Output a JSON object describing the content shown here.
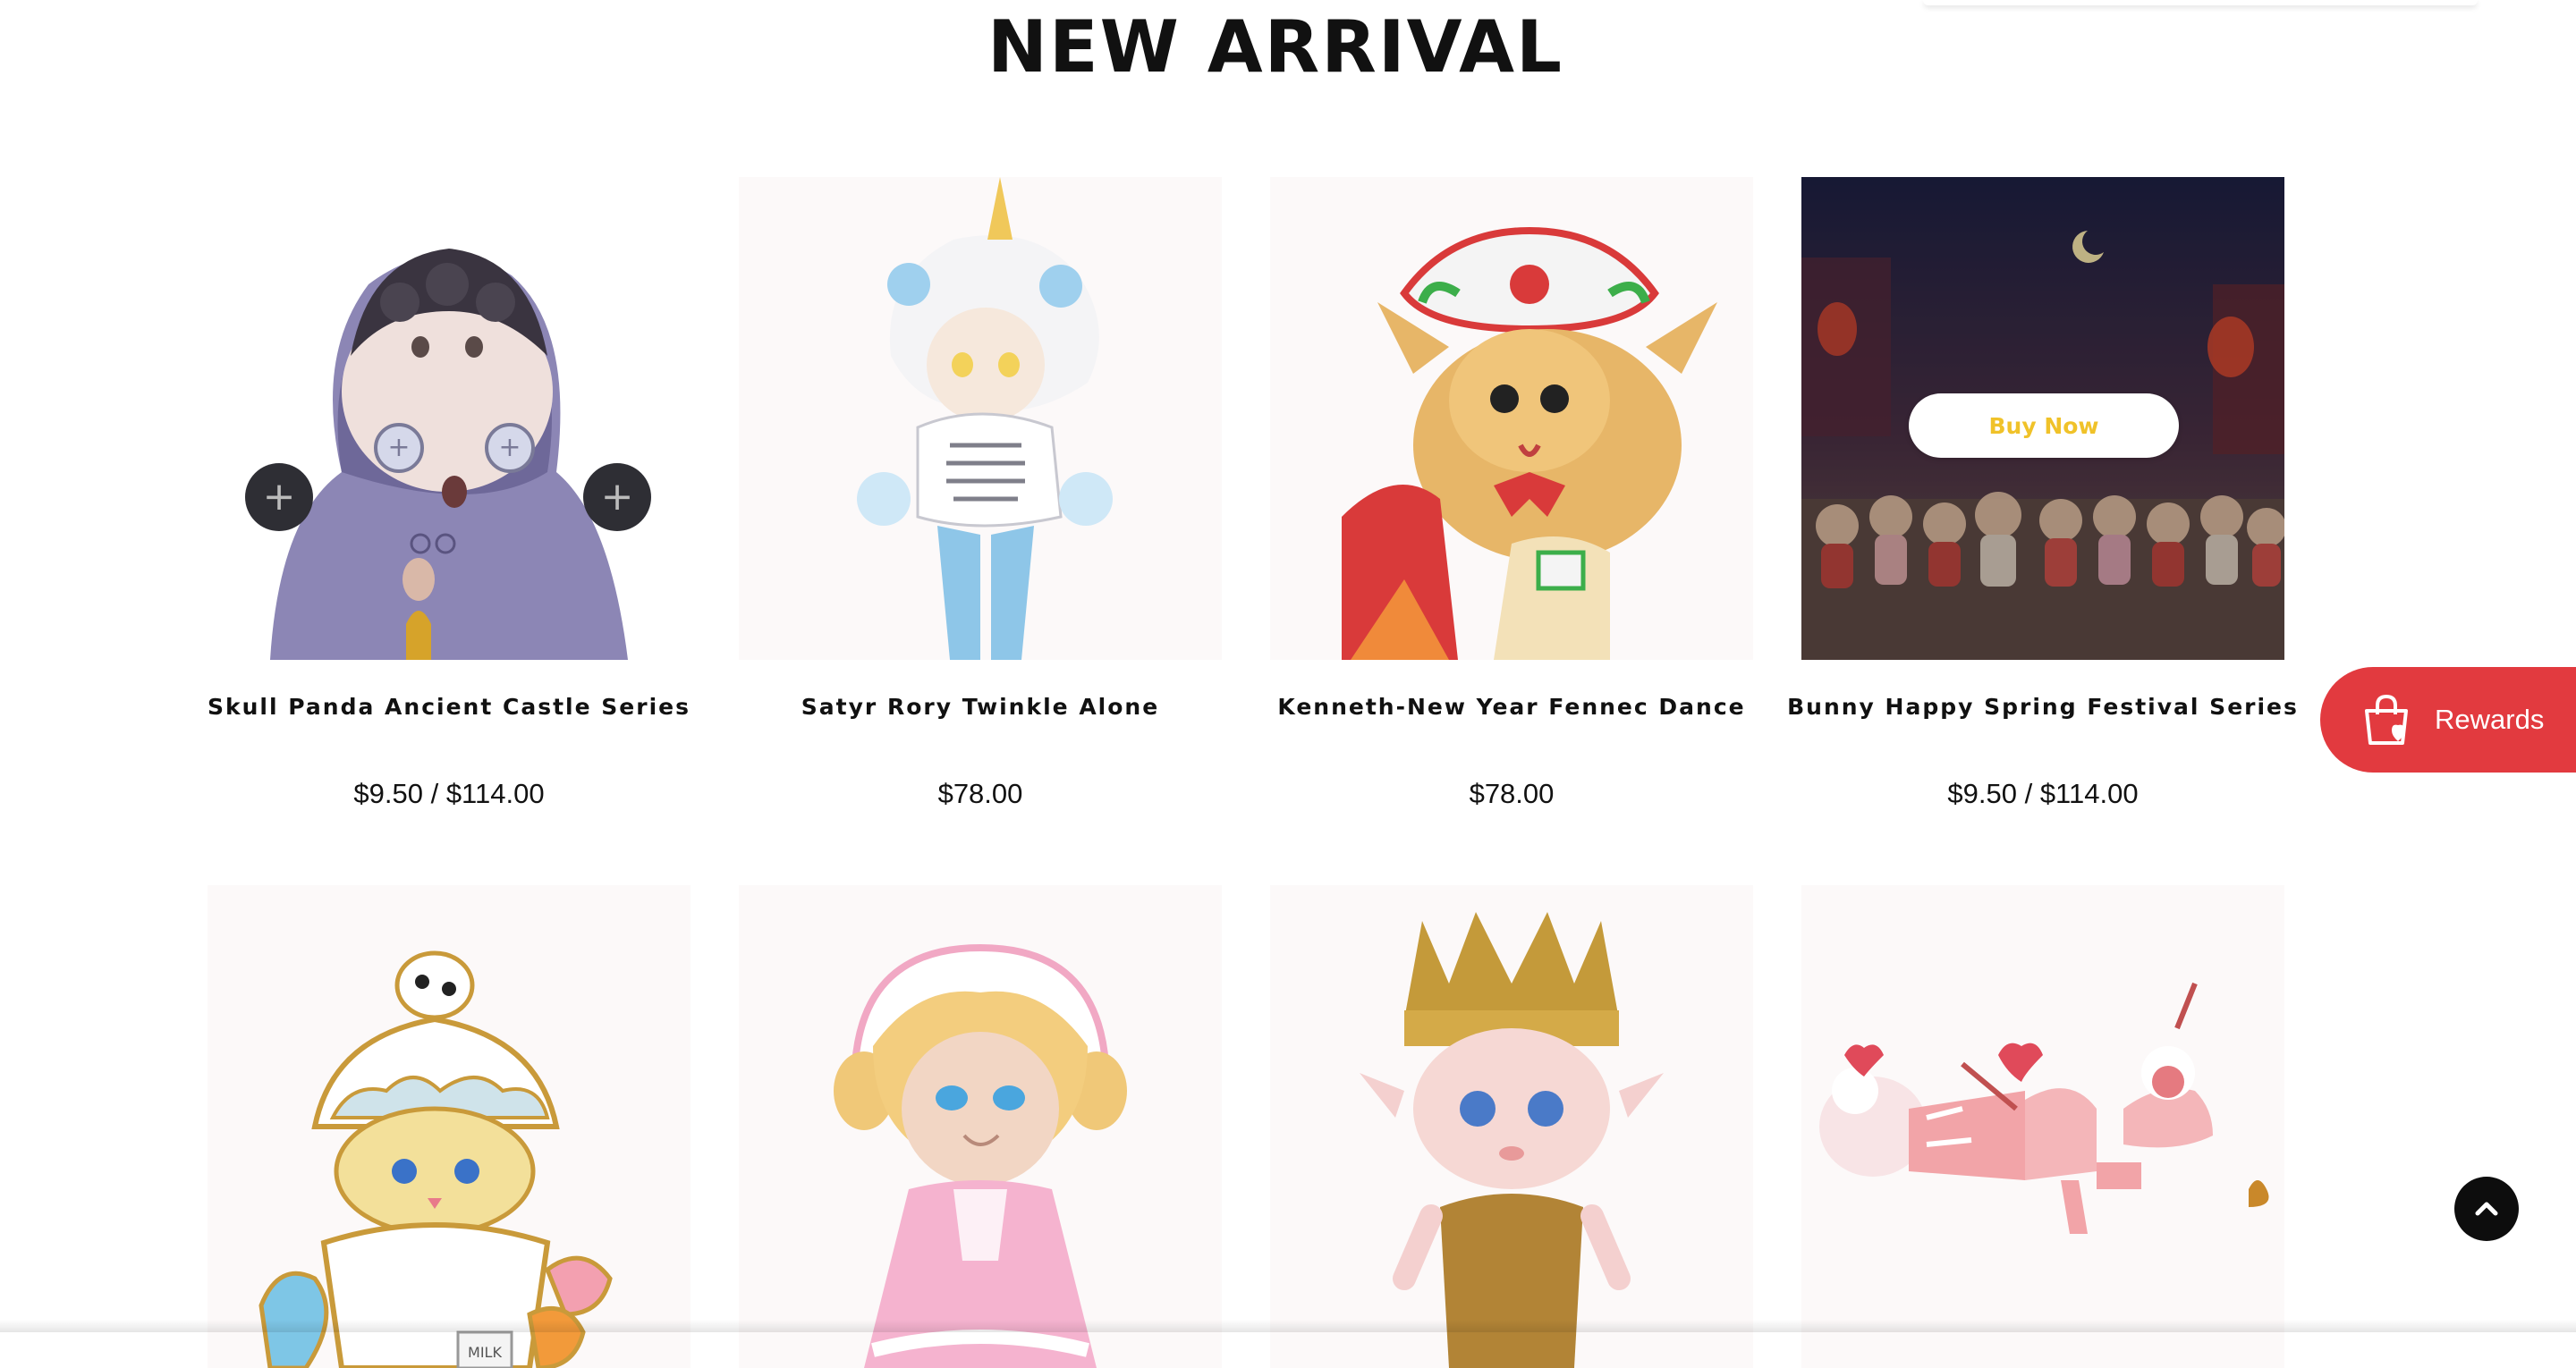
{
  "section": {
    "title": "NEW ARRIVAL"
  },
  "products": [
    {
      "name": "Skull Panda Ancient Castle Series",
      "price": "$9.50 / $114.00",
      "image": "skull-panda-hooded-figure"
    },
    {
      "name": "Satyr Rory Twinkle Alone",
      "price": "$78.00",
      "image": "satyr-rory-snowflake-figure"
    },
    {
      "name": "Kenneth-New Year Fennec Dance",
      "price": "$78.00",
      "image": "fennec-lion-dance-figure"
    },
    {
      "name": "Bunny Happy Spring Festival Series",
      "price": "$9.50 / $114.00",
      "image": "bunny-festival-scene",
      "hover_button": "Buy Now"
    },
    {
      "name": "",
      "price": "",
      "image": "enamel-pin-milk-girl"
    },
    {
      "name": "",
      "price": "",
      "image": "pink-dress-bonnet-figure"
    },
    {
      "name": "",
      "price": "",
      "image": "crowned-green-hair-figure"
    },
    {
      "name": "",
      "price": "",
      "image": "pink-lying-figure-with-tub"
    }
  ],
  "rewards": {
    "label": "Rewards",
    "icon": "shopping-bag-heart-icon",
    "color": "#e23a3f"
  },
  "scroll_top": {
    "icon": "chevron-up-icon"
  },
  "colors": {
    "buy_now_text": "#f0c229",
    "card_bg": "#fcf9f9"
  }
}
